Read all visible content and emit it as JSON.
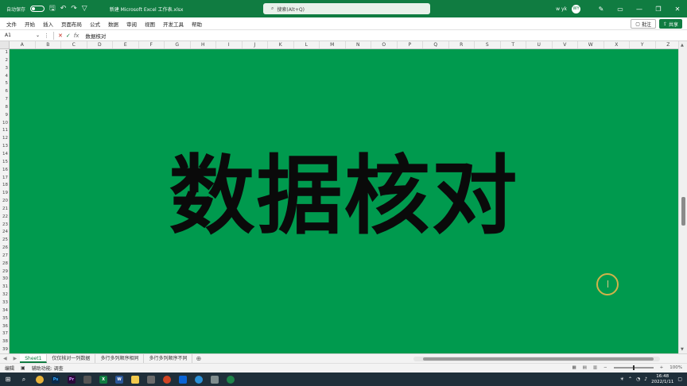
{
  "titlebar": {
    "autosave_label": "自动保存",
    "filename": "新建 Microsoft Excel 工作表.xlsx",
    "search_placeholder": "搜索(Alt+Q)",
    "user": "w yk",
    "avatar": "WY"
  },
  "ribbon": {
    "tabs": [
      "文件",
      "开始",
      "插入",
      "页面布局",
      "公式",
      "数据",
      "审阅",
      "视图",
      "开发工具",
      "帮助"
    ],
    "comment_label": "批注",
    "share_label": "共享"
  },
  "formula": {
    "namebox": "A1",
    "content": "数据核对"
  },
  "grid": {
    "columns": [
      "A",
      "B",
      "C",
      "D",
      "E",
      "F",
      "G",
      "H",
      "I",
      "J",
      "K",
      "L",
      "M",
      "N",
      "O",
      "P",
      "Q",
      "R",
      "S",
      "T",
      "U",
      "V",
      "W",
      "X",
      "Y",
      "Z"
    ],
    "rows": [
      "1",
      "2",
      "3",
      "4",
      "5",
      "6",
      "7",
      "8",
      "9",
      "10",
      "11",
      "12",
      "13",
      "14",
      "15",
      "16",
      "17",
      "18",
      "19",
      "20",
      "21",
      "22",
      "23",
      "24",
      "25",
      "26",
      "27",
      "28",
      "29",
      "30",
      "31",
      "32",
      "33",
      "34",
      "35",
      "36",
      "37",
      "38",
      "39"
    ],
    "fill_color": "#009a4e",
    "big_text": "数据核对"
  },
  "sheets": {
    "tabs": [
      "Sheet1",
      "仅仅核对一列数据",
      "多行多列顺序相同",
      "多行多列顺序不同"
    ],
    "active_index": 0
  },
  "status": {
    "mode": "编辑",
    "accessibility": "辅助功能: 调查",
    "zoom": "100%"
  },
  "taskbar": {
    "time": "16:48",
    "date": "2022/1/11"
  },
  "colors": {
    "excel_green": "#107c41"
  }
}
